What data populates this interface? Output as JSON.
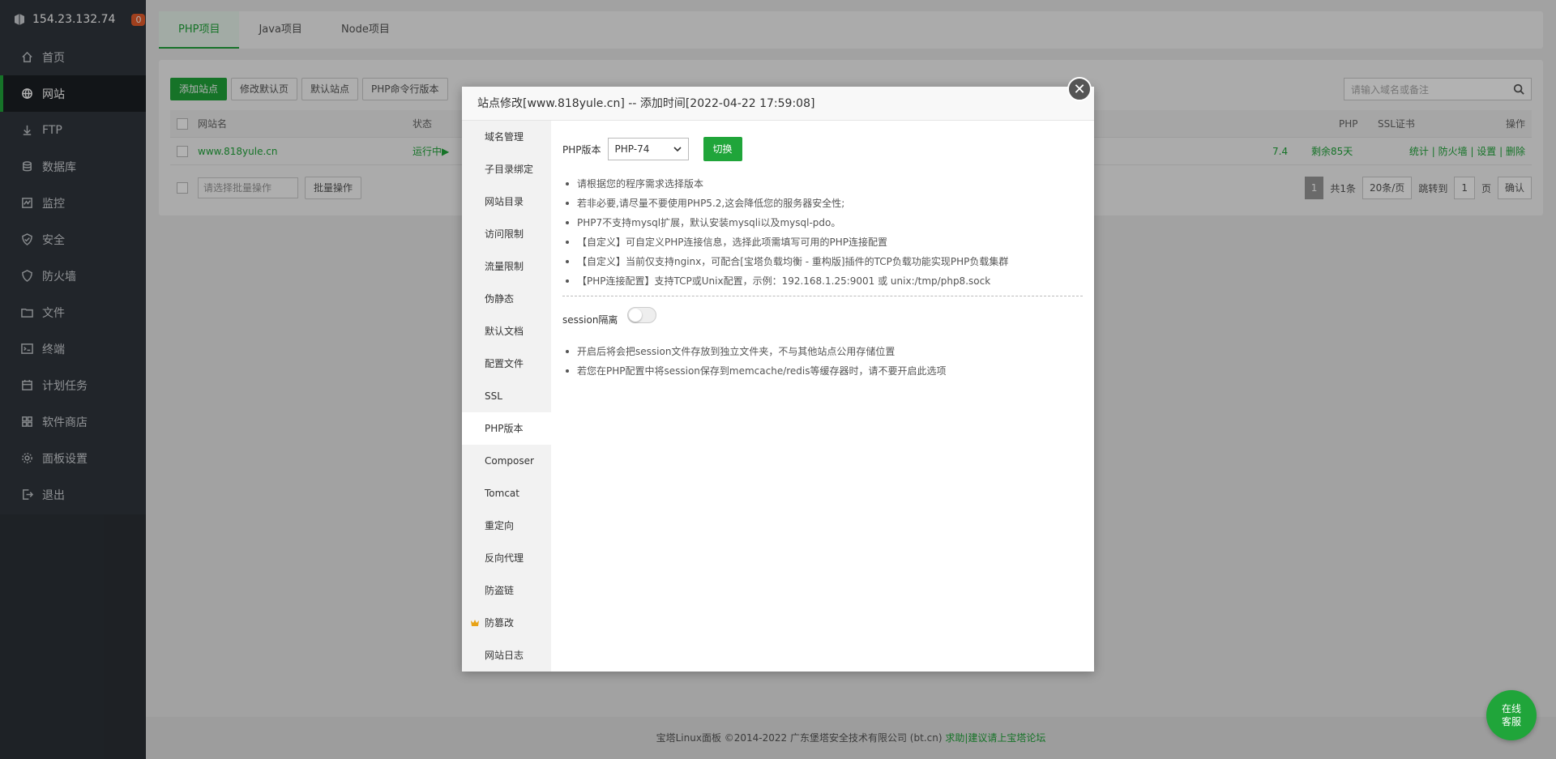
{
  "server": {
    "ip": "154.23.132.74",
    "badge": "0"
  },
  "nav": [
    {
      "label": "首页",
      "icon": "home-icon"
    },
    {
      "label": "网站",
      "icon": "globe-icon",
      "active": true
    },
    {
      "label": "FTP",
      "icon": "ftp-icon"
    },
    {
      "label": "数据库",
      "icon": "database-icon"
    },
    {
      "label": "监控",
      "icon": "monitor-icon"
    },
    {
      "label": "安全",
      "icon": "shield-icon"
    },
    {
      "label": "防火墙",
      "icon": "firewall-icon"
    },
    {
      "label": "文件",
      "icon": "folder-icon"
    },
    {
      "label": "终端",
      "icon": "terminal-icon"
    },
    {
      "label": "计划任务",
      "icon": "calendar-icon"
    },
    {
      "label": "软件商店",
      "icon": "apps-icon"
    },
    {
      "label": "面板设置",
      "icon": "gear-icon"
    },
    {
      "label": "退出",
      "icon": "logout-icon"
    }
  ],
  "tabs": [
    "PHP项目",
    "Java项目",
    "Node项目"
  ],
  "toolbar": {
    "add_site": "添加站点",
    "edit_default": "修改默认页",
    "default_site": "默认站点",
    "php_cli": "PHP命令行版本",
    "search_placeholder": "请输入域名或备注"
  },
  "table": {
    "headers": {
      "name": "网站名",
      "status": "状态",
      "php": "PHP",
      "ssl": "SSL证书",
      "action": "操作"
    },
    "rows": [
      {
        "name": "www.818yule.cn",
        "status": "运行中▶",
        "php": "7.4",
        "ssl": "剩余85天",
        "actions": [
          "统计",
          "防火墙",
          "设置",
          "删除"
        ]
      }
    ],
    "batch_placeholder": "请选择批量操作",
    "batch_button": "批量操作",
    "pager": {
      "current": "1",
      "total": "共1条",
      "per_page": "20条/页",
      "jump_label": "跳转到",
      "jump_value": "1",
      "page_unit": "页",
      "confirm": "确认"
    }
  },
  "footer": {
    "copyright": "宝塔Linux面板 ©2014-2022 广东堡塔安全技术有限公司 (bt.cn)",
    "link": "求助|建议请上宝塔论坛"
  },
  "modal": {
    "title": "站点修改[www.818yule.cn] -- 添加时间[2022-04-22 17:59:08]",
    "side_items": [
      "域名管理",
      "子目录绑定",
      "网站目录",
      "访问限制",
      "流量限制",
      "伪静态",
      "默认文档",
      "配置文件",
      "SSL",
      "PHP版本",
      "Composer",
      "Tomcat",
      "重定向",
      "反向代理",
      "防盗链",
      "防篡改",
      "网站日志"
    ],
    "active_item": "PHP版本",
    "php_label": "PHP版本",
    "php_selected": "PHP-74",
    "switch_button": "切换",
    "tips": [
      "请根据您的程序需求选择版本",
      "若非必要,请尽量不要使用PHP5.2,这会降低您的服务器安全性;",
      "PHP7不支持mysql扩展，默认安装mysqli以及mysql-pdo。",
      "【自定义】可自定义PHP连接信息，选择此项需填写可用的PHP连接配置",
      "【自定义】当前仅支持nginx，可配合[宝塔负载均衡 - 重构版]插件的TCP负载功能实现PHP负载集群",
      "【PHP连接配置】支持TCP或Unix配置，示例：192.168.1.25:9001 或 unix:/tmp/php8.sock"
    ],
    "session_label": "session隔离",
    "session_enabled": false,
    "session_tips": [
      "开启后将会把session文件存放到独立文件夹，不与其他站点公用存储位置",
      "若您在PHP配置中将session保存到memcache/redis等缓存器时，请不要开启此选项"
    ]
  },
  "chat": {
    "line1": "在线",
    "line2": "客服"
  }
}
